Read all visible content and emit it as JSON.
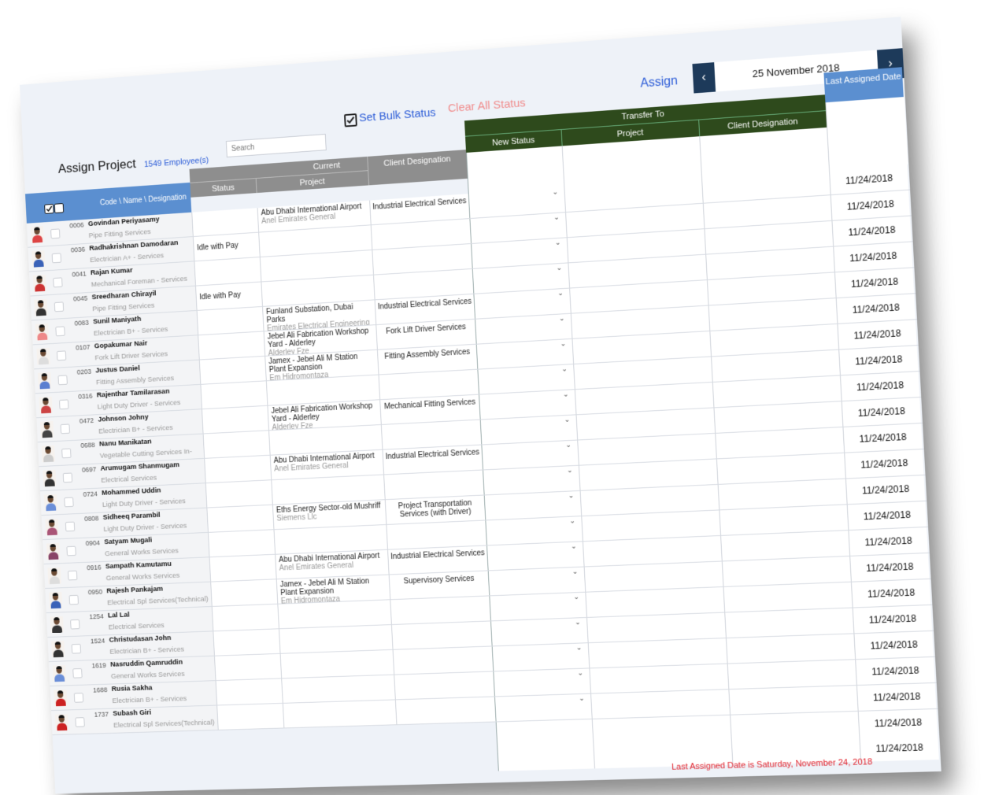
{
  "header": {
    "title": "Assign Project",
    "employee_count": "1549 Employee(s)",
    "search_placeholder": "Search",
    "set_bulk_status": "Set Bulk Status",
    "clear_all_status": "Clear All Status",
    "assign": "Assign",
    "date": "25 November 2018",
    "prev": "‹",
    "next": "›"
  },
  "columns": {
    "code_name": "Code \\ Name \\ Designation",
    "current": "Current",
    "status": "Status",
    "project": "Project",
    "client_designation": "Client Designation",
    "transfer_to": "Transfer To",
    "new_status": "New Status",
    "t_project": "Project",
    "t_client_designation": "Client Designation",
    "last_assigned_date": "Last Assigned Date"
  },
  "rows": [
    {
      "code": "0006",
      "name": "Govindan Periyasamy",
      "designation": "Pipe Fitting Services",
      "status": "",
      "project": "Abu Dhabi International Airport",
      "company": "Anel Emirates General",
      "client_designation": "Industrial Electrical Services",
      "last_date": "11/24/2018",
      "shirt": "#d44"
    },
    {
      "code": "0036",
      "name": "Radhakrishnan Damodaran",
      "designation": "Electrician A+ - Services",
      "status": "Idle with Pay",
      "project": "",
      "company": "",
      "client_designation": "",
      "last_date": "11/24/2018",
      "shirt": "#3a62b8"
    },
    {
      "code": "0041",
      "name": "Rajan Kumar",
      "designation": "Mechanical Foreman - Services",
      "status": "",
      "project": "",
      "company": "",
      "client_designation": "",
      "last_date": "11/24/2018",
      "shirt": "#c33"
    },
    {
      "code": "0045",
      "name": "Sreedharan Chirayil",
      "designation": "Pipe Fitting Services",
      "status": "Idle with Pay",
      "project": "",
      "company": "",
      "client_designation": "",
      "last_date": "11/24/2018",
      "shirt": "#333"
    },
    {
      "code": "0083",
      "name": "Sunil Maniyath",
      "designation": "Electrician B+ - Services",
      "status": "",
      "project": "Funland Substation, Dubai Parks",
      "company": "Emirates Electrical Engineering",
      "client_designation": "Industrial Electrical Services",
      "last_date": "11/24/2018",
      "shirt": "#e88"
    },
    {
      "code": "0107",
      "name": "Gopakumar Nair",
      "designation": "Fork Lift Driver Services",
      "status": "",
      "project": "Jebel Ali Fabrication Workshop Yard - Alderley",
      "company": "Alderley Fze",
      "client_designation": "Fork Lift Driver Services",
      "last_date": "11/24/2018",
      "shirt": "#ddd"
    },
    {
      "code": "0203",
      "name": "Justus Daniel",
      "designation": "Fitting Assembly Services",
      "status": "",
      "project": "Jamex - Jebel Ali M Station Plant Expansion",
      "company": "Em Hidromontaza",
      "client_designation": "Fitting Assembly Services",
      "last_date": "11/24/2018",
      "shirt": "#5a7fd0"
    },
    {
      "code": "0316",
      "name": "Rajenthar Tamilarasan",
      "designation": "Light Duty Driver - Services",
      "status": "",
      "project": "",
      "company": "",
      "client_designation": "",
      "last_date": "11/24/2018",
      "shirt": "#c44"
    },
    {
      "code": "0472",
      "name": "Johnson Johny",
      "designation": "Electrician B+ - Services",
      "status": "",
      "project": "Jebel Ali Fabrication Workshop Yard - Alderley",
      "company": "Alderley Fze",
      "client_designation": "Mechanical Fitting Services",
      "last_date": "11/24/2018",
      "shirt": "#444"
    },
    {
      "code": "0688",
      "name": "Nanu Manikatan",
      "designation": "Vegetable Cutting Services In-",
      "status": "",
      "project": "",
      "company": "",
      "client_designation": "",
      "last_date": "11/24/2018",
      "shirt": "#ccc"
    },
    {
      "code": "0697",
      "name": "Arumugam Shanmugam",
      "designation": "Electrical Services",
      "status": "",
      "project": "Abu Dhabi International Airport",
      "company": "Anel Emirates General",
      "client_designation": "Industrial Electrical Services",
      "last_date": "11/24/2018",
      "shirt": "#333"
    },
    {
      "code": "0724",
      "name": "Mohammed Uddin",
      "designation": "Light Duty Driver - Services",
      "status": "",
      "project": "",
      "company": "",
      "client_designation": "",
      "last_date": "11/24/2018",
      "shirt": "#6a8ed8"
    },
    {
      "code": "0808",
      "name": "Sidheeq Parambil",
      "designation": "Light Duty Driver - Services",
      "status": "",
      "project": "Eths Energy Sector-old Mushriff",
      "company": "Siemens Llc",
      "client_designation": "Project Transportation Services (with Driver)",
      "last_date": "11/24/2018",
      "shirt": "#a57"
    },
    {
      "code": "0904",
      "name": "Satyam Mugali",
      "designation": "General Works  Services",
      "status": "",
      "project": "",
      "company": "",
      "client_designation": "",
      "last_date": "11/24/2018",
      "shirt": "#846"
    },
    {
      "code": "0916",
      "name": "Sampath Kamutamu",
      "designation": "General Works  Services",
      "status": "",
      "project": "Abu Dhabi International Airport",
      "company": "Anel Emirates General",
      "client_designation": "Industrial Electrical Services",
      "last_date": "11/24/2018",
      "shirt": "#ddd"
    },
    {
      "code": "0950",
      "name": "Rajesh Pankajam",
      "designation": "Electrical Spl Services(Technical)",
      "status": "",
      "project": "Jamex - Jebel Ali M Station Plant Expansion",
      "company": "Em Hidromontaza",
      "client_designation": "Supervisory  Services",
      "last_date": "11/24/2018",
      "shirt": "#3a62b8"
    },
    {
      "code": "1254",
      "name": "Lal Lal",
      "designation": "Electrical Services",
      "status": "",
      "project": "",
      "company": "",
      "client_designation": "",
      "last_date": "11/24/2018",
      "shirt": "#333"
    },
    {
      "code": "1524",
      "name": "Christudasan John",
      "designation": "Electrician B+ - Services",
      "status": "",
      "project": "",
      "company": "",
      "client_designation": "",
      "last_date": "11/24/2018",
      "shirt": "#333"
    },
    {
      "code": "1619",
      "name": "Nasruddin Qamruddin",
      "designation": "General Works  Services",
      "status": "",
      "project": "",
      "company": "",
      "client_designation": "",
      "last_date": "11/24/2018",
      "shirt": "#6a8ed8"
    },
    {
      "code": "1688",
      "name": "Rusia Sakha",
      "designation": "Electrician B+ - Services",
      "status": "",
      "project": "",
      "company": "",
      "client_designation": "",
      "last_date": "11/24/2018",
      "shirt": "#c22"
    },
    {
      "code": "1737",
      "name": "Subash Giri",
      "designation": "Electrical Spl Services(Technical)",
      "status": "",
      "project": "",
      "company": "",
      "client_designation": "",
      "last_date": "11/24/2018",
      "shirt": "#c22"
    }
  ],
  "extra_dates": [
    "11/24/2018",
    "11/24/2018"
  ],
  "footer_note": "Last Assigned Date is Saturday, November 24, 2018",
  "colors": {
    "accent_blue": "#2a5bd7",
    "header_blue": "#5b8fd0",
    "transfer_green": "#2e4a1c",
    "current_gray": "#8e8e8e",
    "nav_dark": "#1d3a5a",
    "footer_red": "#e0202a"
  }
}
